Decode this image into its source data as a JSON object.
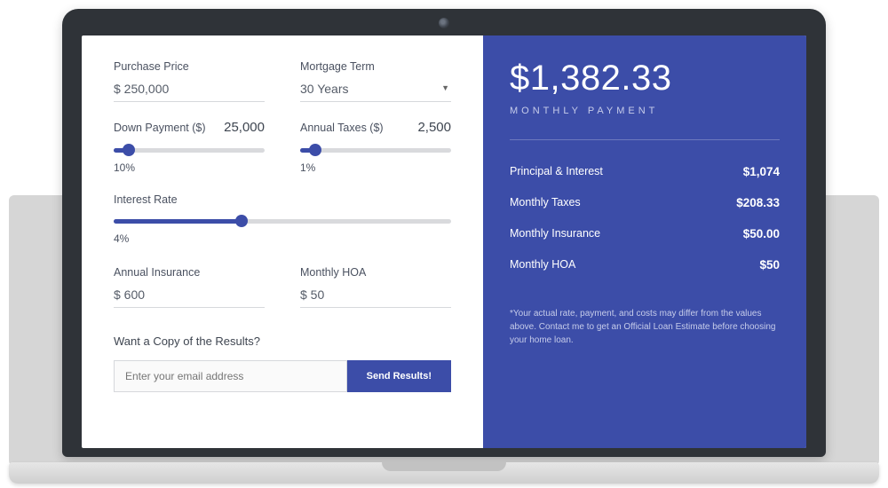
{
  "form": {
    "purchase_price": {
      "label": "Purchase Price",
      "value": "$ 250,000"
    },
    "mortgage_term": {
      "label": "Mortgage Term",
      "value": "30 Years"
    },
    "down_payment": {
      "label": "Down Payment ($)",
      "value": "25,000",
      "percent": "10%",
      "slider_pct": 10
    },
    "annual_taxes": {
      "label": "Annual Taxes ($)",
      "value": "2,500",
      "percent": "1%",
      "slider_pct": 10
    },
    "interest_rate": {
      "label": "Interest Rate",
      "percent": "4%",
      "slider_pct": 38
    },
    "annual_insurance": {
      "label": "Annual Insurance",
      "value": "$ 600"
    },
    "monthly_hoa": {
      "label": "Monthly HOA",
      "value": "$ 50"
    }
  },
  "copy": {
    "title": "Want a Copy of the Results?",
    "placeholder": "Enter your email address",
    "button": "Send Results!"
  },
  "summary": {
    "total": "$1,382.33",
    "total_label": "MONTHLY PAYMENT",
    "rows": [
      {
        "label": "Principal & Interest",
        "value": "$1,074"
      },
      {
        "label": "Monthly Taxes",
        "value": "$208.33"
      },
      {
        "label": "Monthly Insurance",
        "value": "$50.00"
      },
      {
        "label": "Monthly HOA",
        "value": "$50"
      }
    ],
    "disclaimer": "*Your actual rate, payment, and costs may differ from the values above. Contact me to get an Official Loan Estimate before choosing your home loan."
  }
}
